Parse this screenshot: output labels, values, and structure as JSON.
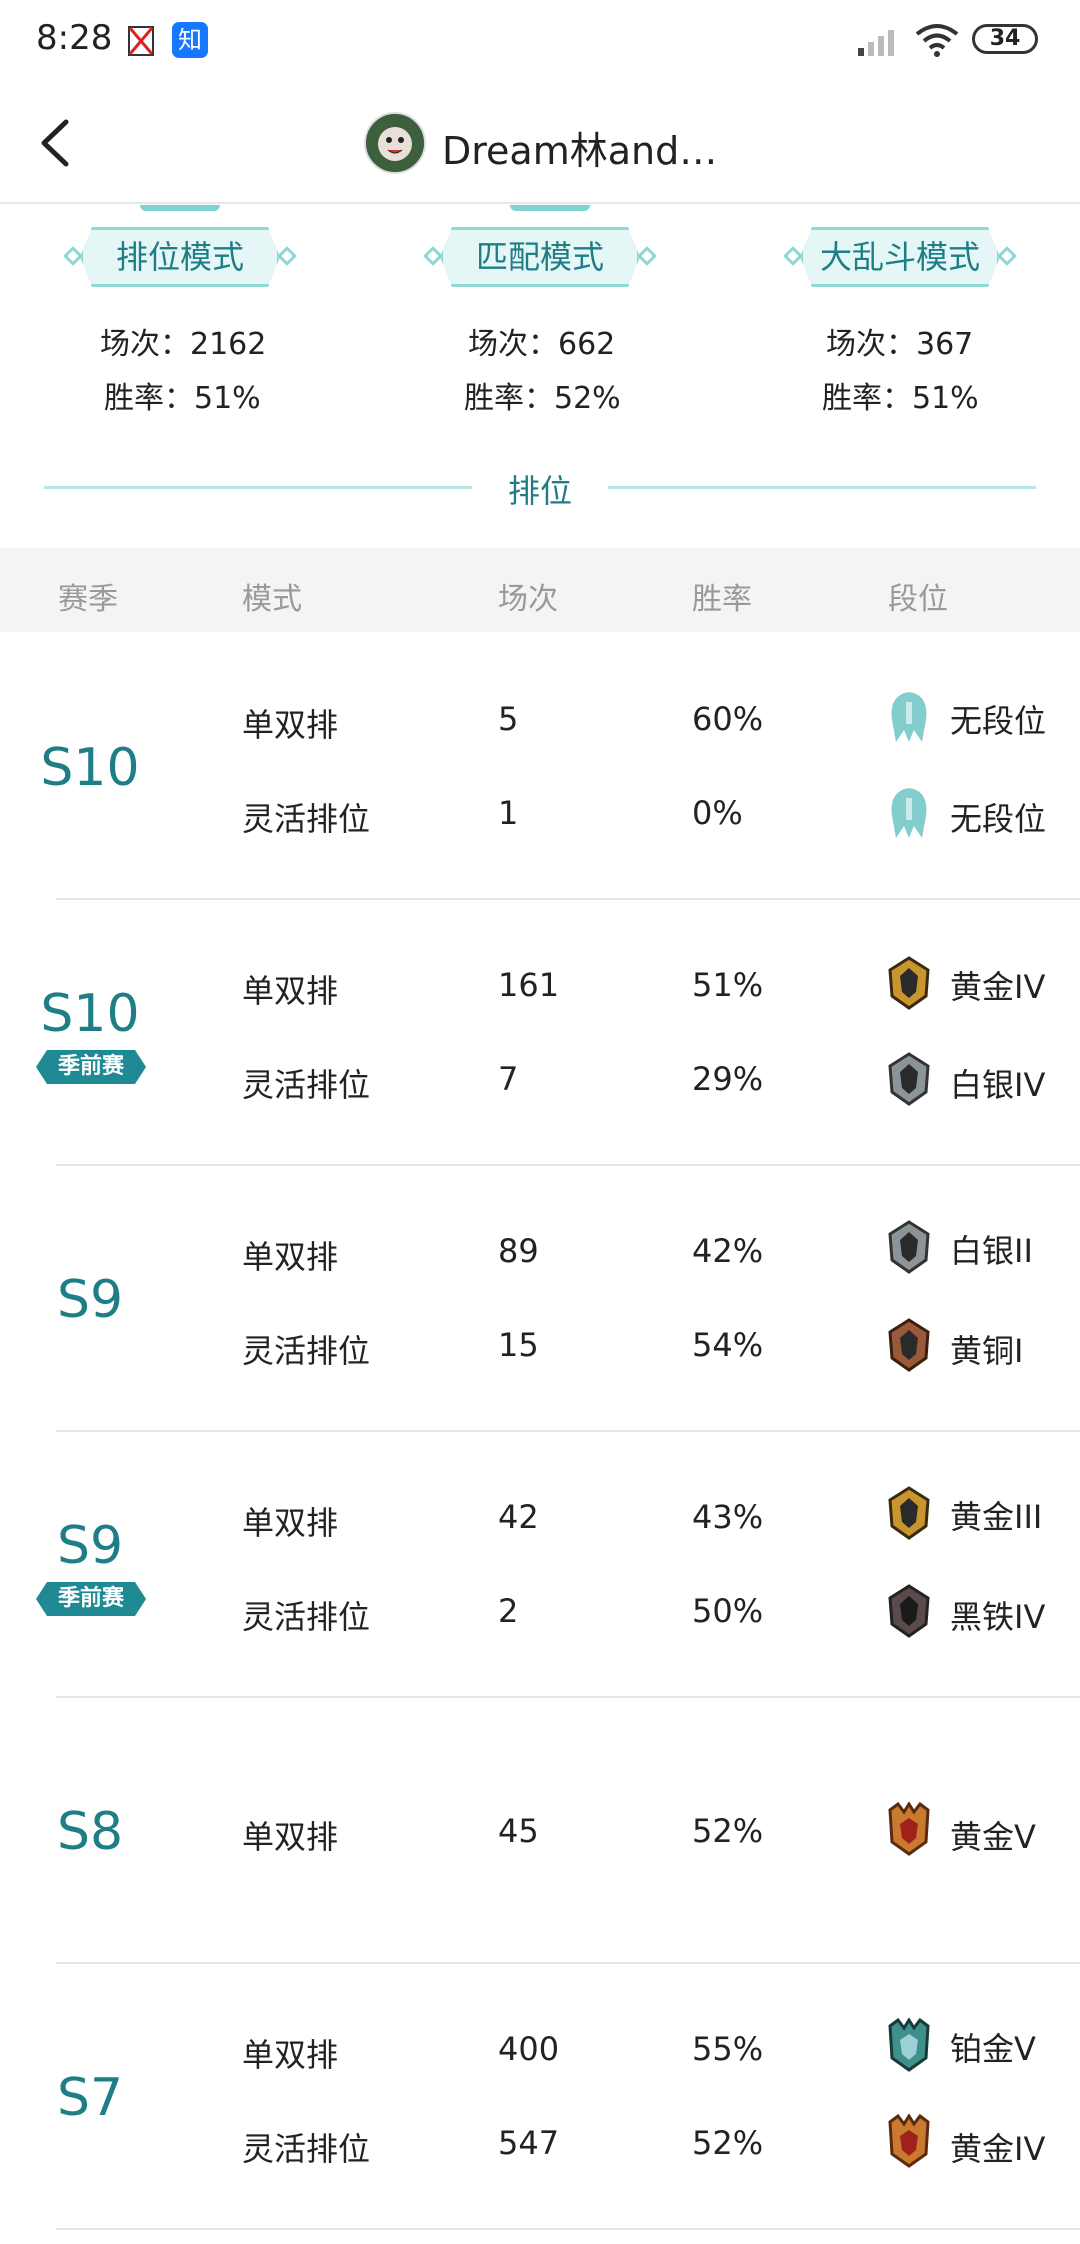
{
  "status_bar": {
    "time": "8:28",
    "app_icon_label": "知",
    "battery": "34"
  },
  "header": {
    "title": "Dream林and…"
  },
  "modes": [
    {
      "name": "排位模式",
      "games": "场次：2162",
      "winrate": "胜率：51%"
    },
    {
      "name": "匹配模式",
      "games": "场次：662",
      "winrate": "胜率：52%"
    },
    {
      "name": "大乱斗模式",
      "games": "场次：367",
      "winrate": "胜率：51%"
    }
  ],
  "section_title": "排位",
  "table": {
    "headers": [
      "赛季",
      "模式",
      "场次",
      "胜率",
      "段位"
    ],
    "seasons": [
      {
        "season": "S10",
        "badge": "",
        "rows": [
          {
            "mode": "单双排",
            "games": "5",
            "winrate": "60%",
            "rank": "无段位",
            "rank_color": "#5bbcbf"
          },
          {
            "mode": "灵活排位",
            "games": "1",
            "winrate": "0%",
            "rank": "无段位",
            "rank_color": "#5bbcbf"
          }
        ]
      },
      {
        "season": "S10",
        "badge": "季前赛",
        "rows": [
          {
            "mode": "单双排",
            "games": "161",
            "winrate": "51%",
            "rank": "黄金IV",
            "rank_color": "#c9952e"
          },
          {
            "mode": "灵活排位",
            "games": "7",
            "winrate": "29%",
            "rank": "白银IV",
            "rank_color": "#8a9499"
          }
        ]
      },
      {
        "season": "S9",
        "badge": "",
        "rows": [
          {
            "mode": "单双排",
            "games": "89",
            "winrate": "42%",
            "rank": "白银II",
            "rank_color": "#8a9499"
          },
          {
            "mode": "灵活排位",
            "games": "15",
            "winrate": "54%",
            "rank": "黄铜I",
            "rank_color": "#9a5a3a"
          }
        ]
      },
      {
        "season": "S9",
        "badge": "季前赛",
        "rows": [
          {
            "mode": "单双排",
            "games": "42",
            "winrate": "43%",
            "rank": "黄金III",
            "rank_color": "#c9952e"
          },
          {
            "mode": "灵活排位",
            "games": "2",
            "winrate": "50%",
            "rank": "黑铁IV",
            "rank_color": "#5a4a4a"
          }
        ]
      },
      {
        "season": "S8",
        "badge": "",
        "rows": [
          {
            "mode": "单双排",
            "games": "45",
            "winrate": "52%",
            "rank": "黄金V",
            "rank_color": "#c97a2e"
          }
        ]
      },
      {
        "season": "S7",
        "badge": "",
        "rows": [
          {
            "mode": "单双排",
            "games": "400",
            "winrate": "55%",
            "rank": "铂金V",
            "rank_color": "#3f8f8a"
          },
          {
            "mode": "灵活排位",
            "games": "547",
            "winrate": "52%",
            "rank": "黄金IV",
            "rank_color": "#c97a2e"
          }
        ]
      }
    ]
  }
}
